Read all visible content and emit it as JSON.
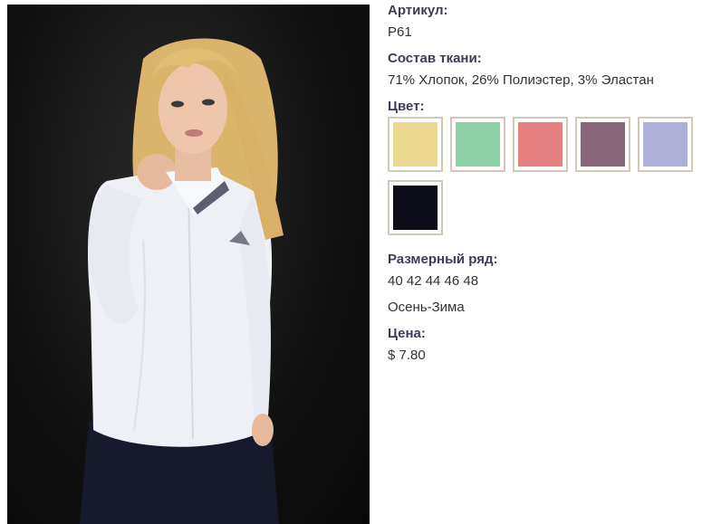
{
  "product": {
    "image_alt": "Белая блузка",
    "article_label": "Артикул:",
    "article_value": "P61",
    "composition_label": "Состав ткани:",
    "composition_value": "71% Хлопок, 26% Полиэстер, 3% Эластан",
    "color_label": "Цвет:",
    "colors": [
      {
        "name": "yellow",
        "hex": "#ecd88f"
      },
      {
        "name": "mint",
        "hex": "#8ed1a6"
      },
      {
        "name": "pink",
        "hex": "#e48080"
      },
      {
        "name": "mauve",
        "hex": "#8a6579"
      },
      {
        "name": "lavender",
        "hex": "#aeb0d7"
      },
      {
        "name": "black",
        "hex": "#0b0c17"
      }
    ],
    "size_label": "Размерный ряд:",
    "size_value": "40 42 44 46 48",
    "season": "Осень-Зима",
    "price_label": "Цена:",
    "price_value": "$ 7.80"
  }
}
